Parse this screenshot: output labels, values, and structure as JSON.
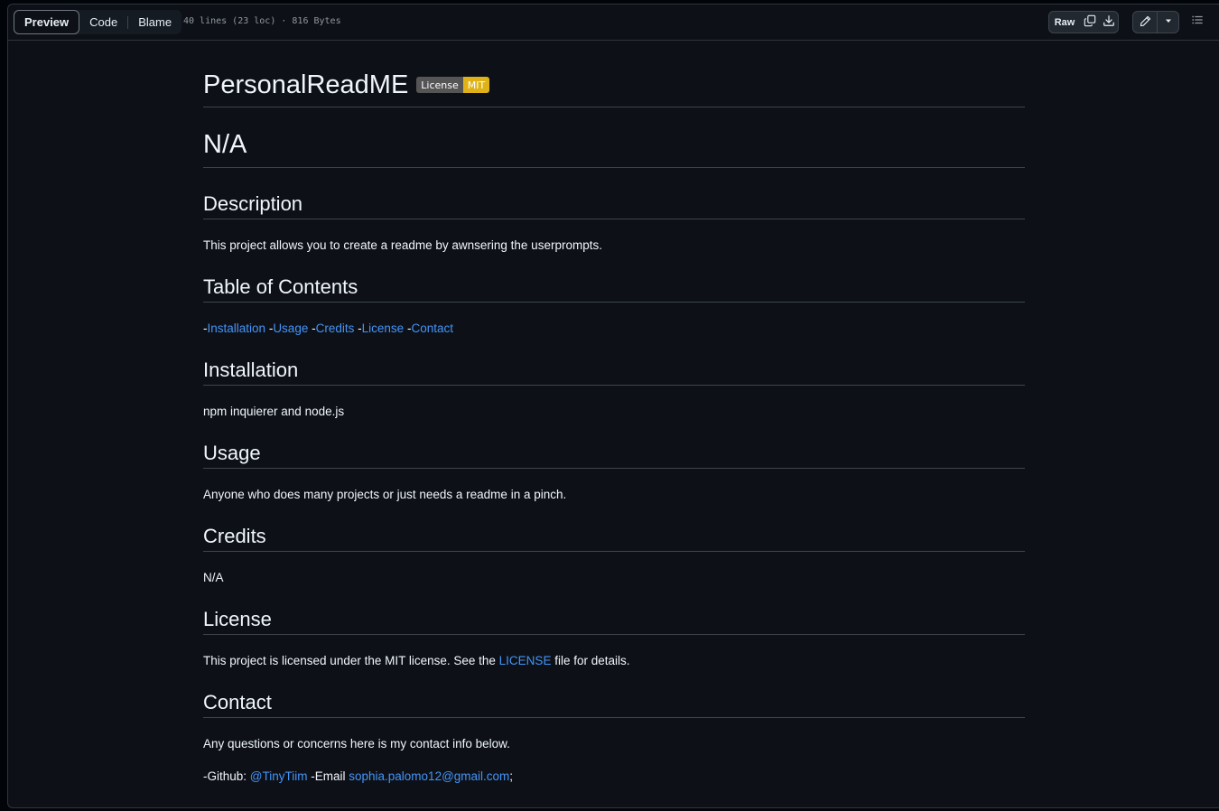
{
  "toolbar": {
    "tabs": [
      {
        "label": "Preview",
        "active": true
      },
      {
        "label": "Code",
        "active": false
      },
      {
        "label": "Blame",
        "active": false
      }
    ],
    "file_info": "40 lines (23 loc) · 816 Bytes",
    "raw_label": "Raw",
    "icons": [
      "copy-icon",
      "download-icon",
      "pencil-icon",
      "triangle-down-icon",
      "list-unordered-icon"
    ]
  },
  "readme": {
    "title": "PersonalReadME",
    "badge": {
      "left": "License",
      "right": "MIT",
      "right_color": "#dfb317"
    },
    "subtitle": "N/A",
    "sections": {
      "description": {
        "heading": "Description",
        "text": "This project allows you to create a readme by awnsering the userprompts."
      },
      "toc": {
        "heading": "Table of Contents",
        "dash": "-",
        "links": [
          "Installation",
          "Usage",
          "Credits",
          "License",
          "Contact"
        ]
      },
      "installation": {
        "heading": "Installation",
        "text": "npm inquierer and node.js"
      },
      "usage": {
        "heading": "Usage",
        "text": "Anyone who does many projects or just needs a readme in a pinch."
      },
      "credits": {
        "heading": "Credits",
        "text": "N/A"
      },
      "license": {
        "heading": "License",
        "text_before": "This project is licensed under the MIT license. See the ",
        "link": "LICENSE",
        "text_after": " file for details."
      },
      "contact": {
        "heading": "Contact",
        "text": "Any questions or concerns here is my contact info below.",
        "github_label": "-Github: ",
        "github_link": "@TinyTiim",
        "email_label": " -Email ",
        "email_link": "sophia.palomo12@gmail.com",
        "trailing": ";"
      }
    }
  },
  "colors": {
    "background": "#0d1117",
    "link": "#4493f8",
    "text": "#f0f6fc",
    "border": "#3d444d"
  }
}
